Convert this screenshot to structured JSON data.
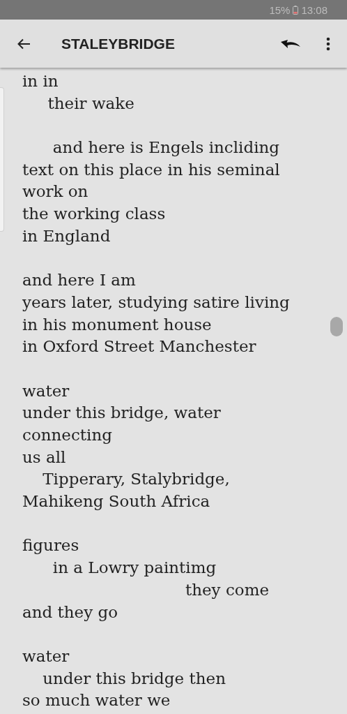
{
  "status_bar": {
    "battery": "15%",
    "time": "13:08"
  },
  "toolbar": {
    "title": "STALEYBRIDGE"
  },
  "stanzas": [
    [
      "in in",
      "     their wake"
    ],
    [
      "      and here is Engels incliding",
      "text on this place in his seminal",
      "work on",
      "the working class",
      "in England"
    ],
    [
      "and here I am",
      "years later, studying satire living",
      "in his monument house",
      "in Oxford Street Manchester"
    ],
    [
      "water",
      "under this bridge, water",
      "connecting",
      "us all",
      "    Tipperary, Stalybridge,",
      "Mahikeng South Africa"
    ],
    [
      "figures",
      "      in a Lowry paintimg",
      "                                they come",
      "and they go"
    ],
    [
      "water",
      "    under this bridge then",
      "so much water we"
    ]
  ]
}
